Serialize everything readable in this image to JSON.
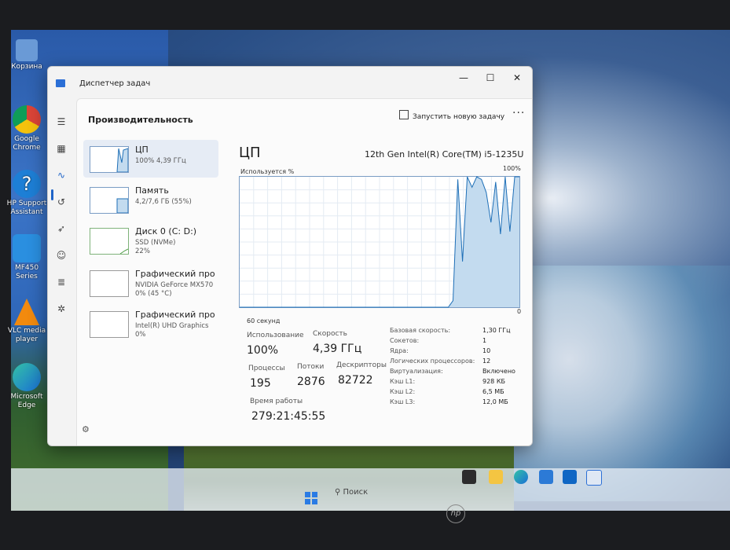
{
  "desktop": {
    "icons": [
      {
        "label": "Корзина",
        "icon": "recycle-bin-icon"
      },
      {
        "label": "Google Chrome",
        "icon": "chrome-icon"
      },
      {
        "label": "HP Support Assistant",
        "icon": "help-icon"
      },
      {
        "label": "MF450 Series",
        "icon": "printer-icon"
      },
      {
        "label": "VLC media player",
        "icon": "vlc-icon"
      },
      {
        "label": "Microsoft Edge",
        "icon": "edge-icon"
      }
    ]
  },
  "window": {
    "title": "Диспетчер задач",
    "controls": {
      "minimize": "—",
      "maximize": "☐",
      "close": "✕"
    }
  },
  "rail": {
    "icons": [
      "menu-icon",
      "processes-icon",
      "performance-icon",
      "history-icon",
      "startup-icon",
      "users-icon",
      "details-icon",
      "services-icon"
    ],
    "settings_icon": "⚙"
  },
  "header": {
    "title": "Производительность",
    "new_task": "Запустить новую задачу",
    "more": "···"
  },
  "devices": [
    {
      "name": "ЦП",
      "sub1": "100% 4,39 ГГц",
      "sub2": ""
    },
    {
      "name": "Память",
      "sub1": "4,2/7,6 ГБ (55%)",
      "sub2": ""
    },
    {
      "name": "Диск 0 (C: D:)",
      "sub1": "SSD (NVMe)",
      "sub2": "22%"
    },
    {
      "name": "Графический про",
      "sub1": "NVIDIA GeForce MX570",
      "sub2": "0% (45 °C)"
    },
    {
      "name": "Графический про",
      "sub1": "Intel(R) UHD Graphics",
      "sub2": "0%"
    }
  ],
  "detail": {
    "heading": "ЦП",
    "model": "12th Gen Intel(R) Core(TM) i5-1235U",
    "graph_label": "Используется %",
    "graph_max": "100%",
    "graph_min": "0",
    "graph_span": "60 секунд",
    "stats": {
      "usage_label": "Использование",
      "usage": "100%",
      "speed_label": "Скорость",
      "speed": "4,39 ГГц",
      "processes_label": "Процессы",
      "processes": "195",
      "threads_label": "Потоки",
      "threads": "2876",
      "handles_label": "Дескрипторы",
      "handles": "82722",
      "uptime_label": "Время работы",
      "uptime": "279:21:45:55"
    },
    "specs": [
      {
        "k": "Базовая скорость:",
        "v": "1,30 ГГц"
      },
      {
        "k": "Сокетов:",
        "v": "1"
      },
      {
        "k": "Ядра:",
        "v": "10"
      },
      {
        "k": "Логических процессоров:",
        "v": "12"
      },
      {
        "k": "Виртуализация:",
        "v": "Включено"
      },
      {
        "k": "Кэш L1:",
        "v": "928 КБ"
      },
      {
        "k": "Кэш L2:",
        "v": "6,5 МБ"
      },
      {
        "k": "Кэш L3:",
        "v": "12,0 МБ"
      }
    ]
  },
  "cpu_history": [
    0,
    0,
    0,
    0,
    0,
    0,
    0,
    0,
    0,
    0,
    0,
    0,
    0,
    0,
    0,
    0,
    0,
    0,
    0,
    0,
    0,
    0,
    0,
    0,
    0,
    0,
    0,
    0,
    0,
    0,
    0,
    0,
    0,
    0,
    0,
    0,
    0,
    0,
    0,
    0,
    0,
    0,
    0,
    0,
    0,
    5,
    98,
    35,
    100,
    92,
    100,
    98,
    88,
    65,
    96,
    56,
    100,
    58,
    100,
    100
  ],
  "taskbar": {
    "search_placeholder": "Поиск",
    "start_icon": "windows-start-icon",
    "apps": [
      "file-explorer-icon",
      "folder-icon",
      "edge-icon",
      "store-icon",
      "outlook-icon",
      "task-manager-icon"
    ]
  },
  "colors": {
    "accent": "#1f64c8",
    "graph_fill": "#c3dbef",
    "graph_line": "#1e6fb7"
  }
}
